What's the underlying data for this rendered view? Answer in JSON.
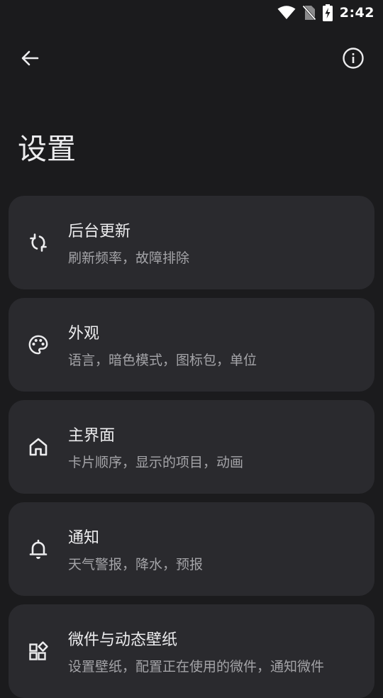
{
  "status_bar": {
    "time": "2:42",
    "icons": [
      "wifi-icon",
      "no-sim-icon",
      "battery-charging-icon"
    ]
  },
  "top_bar": {
    "back_icon": "arrow-back-icon",
    "info_icon": "info-icon"
  },
  "page": {
    "title": "设置"
  },
  "settings": [
    {
      "icon": "sync-icon",
      "title": "后台更新",
      "subtitle": "刷新频率，故障排除"
    },
    {
      "icon": "palette-icon",
      "title": "外观",
      "subtitle": "语言，暗色模式，图标包，单位"
    },
    {
      "icon": "home-icon",
      "title": "主界面",
      "subtitle": "卡片顺序，显示的项目，动画"
    },
    {
      "icon": "bell-icon",
      "title": "通知",
      "subtitle": "天气警报，降水，预报"
    },
    {
      "icon": "widgets-icon",
      "title": "微件与动态壁纸",
      "subtitle": "设置壁纸，配置正在使用的微件，通知微件"
    }
  ],
  "colors": {
    "background": "#1b1b1d",
    "card": "#2a2a2e",
    "text_primary": "#ececee",
    "text_secondary": "#a4a4a8"
  }
}
